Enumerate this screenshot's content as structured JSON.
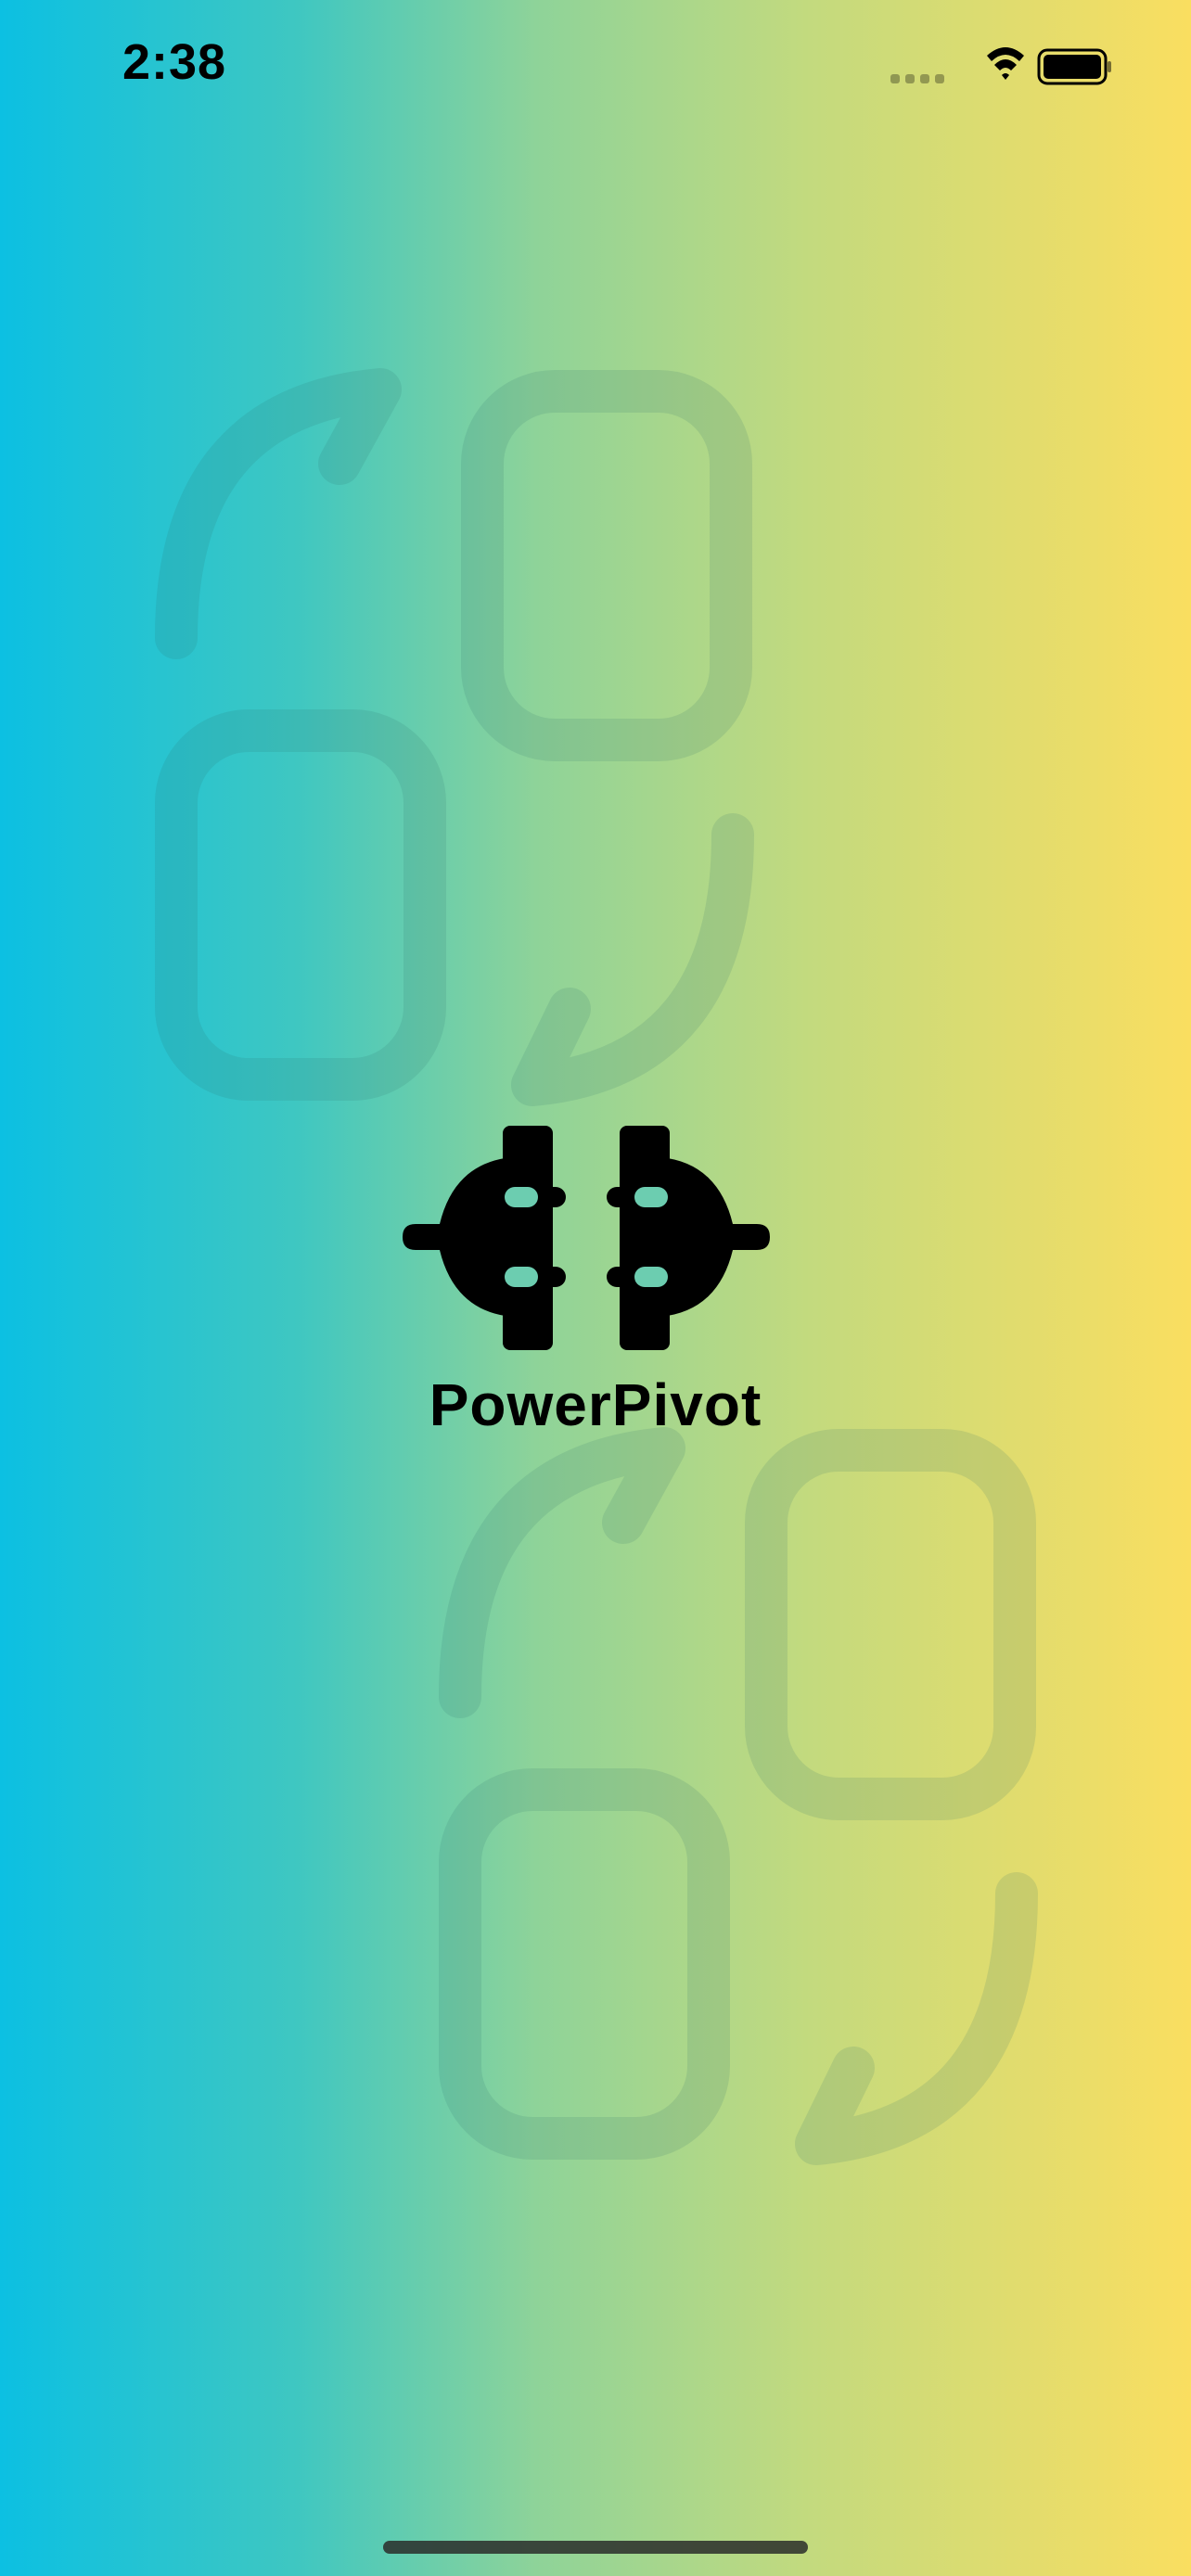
{
  "status_bar": {
    "time": "2:38",
    "signal_icon": "cellular-signal-icon",
    "wifi_icon": "wifi-icon",
    "battery_icon": "battery-icon"
  },
  "splash": {
    "logo_icon": "plug-connector-icon",
    "background_icon": "swap-pages-icon",
    "app_name": "PowerPivot"
  },
  "colors": {
    "gradient_left": "#0cc0e2",
    "gradient_mid": "#8ed399",
    "gradient_right": "#fade60",
    "watermark": "#2a6a6a",
    "text": "#000000"
  }
}
